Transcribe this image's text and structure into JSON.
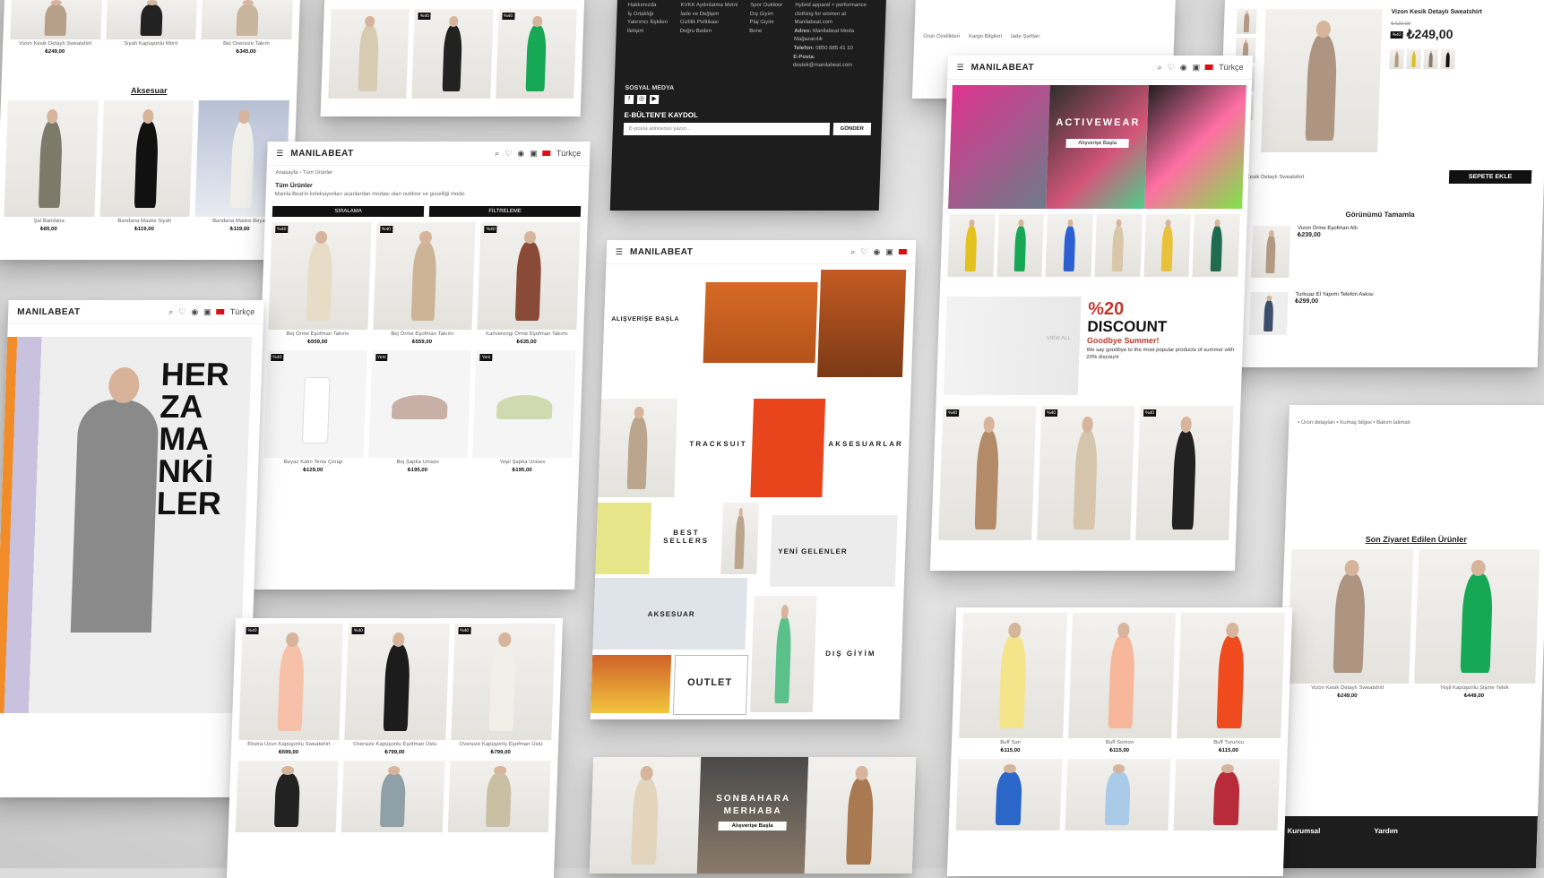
{
  "brand": "MANILABEAT",
  "header": {
    "lang": "Türkçe",
    "currency": "TRY"
  },
  "card_accessories": {
    "products": [
      {
        "name": "Vizon Kesik Detaylı Sweatshirt",
        "price": "₺249,00"
      },
      {
        "name": "Siyah Kapüşonlu Mont",
        "price": ""
      },
      {
        "name": "Bej Oversize Takım",
        "price": "₺345,00"
      }
    ],
    "section_title": "Aksesuar",
    "accessories": [
      {
        "name": "Şal Bandana",
        "price": "₺85,00"
      },
      {
        "name": "Bandana Maske Siyah",
        "price": "₺119,00"
      },
      {
        "name": "Bandana Maske Beyaz",
        "price": "₺119,00"
      }
    ]
  },
  "card_listing": {
    "breadcrumb": "Anasayfa › Tüm Ürünler",
    "title": "Tüm Ürünler",
    "description": "Manila Beat'in koleksiyonları acanlardan modası olan outdoor ve güzelliği mode.",
    "sort_button": "SIRALAMA",
    "filter_button": "FİLTRELEME",
    "products": [
      {
        "name": "Bej Örme Eşofman Takımı",
        "price": "₺559,00",
        "color": "#e9dcc6"
      },
      {
        "name": "Bej Örme Eşofman Takımı",
        "price": "₺559,00",
        "color": "#cdb497"
      },
      {
        "name": "Kahverengi Örme Eşofman Takımı",
        "price": "₺635,00",
        "color": "#8a4a38"
      },
      {
        "name": "Beyaz Kalın Tenis Çorap",
        "price": "₺129,00",
        "color": "#f6f6f6"
      },
      {
        "name": "Bej Şapka Unisex",
        "price": "₺195,00",
        "color": "#c8b0a6"
      },
      {
        "name": "Yeşil Şapka Unisex",
        "price": "₺195,00",
        "color": "#cfdab0"
      }
    ]
  },
  "card_footer": {
    "links_col1": [
      "Hakkımızda",
      "İş Ortaklığı",
      "Yatırımcı İlişkileri",
      "İletişim"
    ],
    "links_col2": [
      "KVKK Aydınlatma Metni",
      "İade ve Değişim",
      "Gizlilik Politikası",
      "Doğru Beden"
    ],
    "links_col3": [
      "Spor Outdoor",
      "Dış Giyim",
      "Plaj Giyim",
      "Bone"
    ],
    "about": "Hybrid apparel + performance clothing for women at Manilabeat.com",
    "address_label": "Adres:",
    "address": "Manilabeat Moda Mağazacılık",
    "phone_label": "Telefon:",
    "phone": "0850 885 41 10",
    "email_label": "E-Posta:",
    "email": "destek@manilabeat.com",
    "social_title": "SOSYAL MEDYA",
    "newsletter_title": "E-BÜLTEN'E KAYDOL",
    "newsletter_placeholder": "E-posta adresinizi yazın...",
    "send_button": "GÖNDER"
  },
  "card_home": {
    "hero_cta": "ALIŞVERİŞE BAŞLA",
    "categories": [
      "TRACKSUIT",
      "AKSESUARLAR",
      "BEST SELLERS",
      "YENİ GELENLER",
      "AKSESUAR",
      "OUTLET",
      "DIŞ GİYİM"
    ]
  },
  "card_activewear": {
    "banner_title": "ACTIVEWEAR",
    "banner_cta": "Alışverişe Başla",
    "discount_title": "%20",
    "discount_word": "DISCOUNT",
    "discount_sub": "Goodbye Summer!",
    "discount_text": "We say goodbye to the most popular products of summer with 20% discount",
    "view_all": "VIEW ALL"
  },
  "card_product": {
    "name": "Vizon Kesik Detaylı Sweatshirt",
    "old_price": "₺429,00",
    "price": "₺249,00",
    "add_to_cart": "SEPETE EKLE",
    "complete_look_title": "Görünümü Tamamla",
    "look_items": [
      {
        "name": "Vizon Örme Eşofman Altı",
        "price": "₺239,00"
      },
      {
        "name": "Turkuaz El Yapımı Telefon Askısı",
        "price": "₺299,00"
      }
    ]
  },
  "card_recent": {
    "title": "Son Ziyaret Edilen Ürünler",
    "products": [
      {
        "name": "Vizon Kesik Detaylı Sweatshirt",
        "price": "₺249,00"
      },
      {
        "name": "Yeşil Kapüşonlu Şişme Yelek",
        "price": "₺449,00"
      }
    ],
    "footer_cols": [
      "Kurumsal",
      "Yardım"
    ]
  },
  "card_hoodies": {
    "products": [
      {
        "name": "Buff Sarı",
        "price": "₺115,00"
      },
      {
        "name": "Buff Somon",
        "price": "₺115,00"
      },
      {
        "name": "Buff Turuncu",
        "price": "₺115,00"
      }
    ]
  },
  "card_hero": {
    "lines": [
      "HER",
      "ZA",
      "MA",
      "NKİ",
      "LER"
    ]
  },
  "card_autumn": {
    "title": "SONBAHARA MERHABA",
    "cta": "Alışverişe Başla"
  },
  "card_jacket_list": {
    "products": [
      {
        "name": "Ekstra Uzun Kapüşonlu Sweatshirt",
        "price": "₺599,00"
      },
      {
        "name": "Oversize Kapüşonlu Eşofman Üstü",
        "price": "₺799,00"
      },
      {
        "name": "Oversize Kapüşonlu Eşofman Üstü",
        "price": "₺799,00"
      }
    ]
  }
}
